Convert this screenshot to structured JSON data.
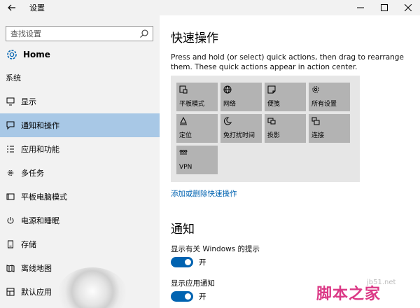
{
  "window": {
    "title": "设置"
  },
  "sidebar": {
    "search_placeholder": "查找设置",
    "home_label": "Home",
    "section_title": "系统",
    "items": [
      {
        "label": "显示",
        "icon": "display-icon"
      },
      {
        "label": "通知和操作",
        "icon": "notification-icon",
        "active": true
      },
      {
        "label": "应用和功能",
        "icon": "apps-list-icon"
      },
      {
        "label": "多任务",
        "icon": "multitask-icon"
      },
      {
        "label": "平板电脑模式",
        "icon": "tablet-icon"
      },
      {
        "label": "电源和睡眠",
        "icon": "power-icon"
      },
      {
        "label": "存储",
        "icon": "storage-icon"
      },
      {
        "label": "离线地图",
        "icon": "map-icon"
      },
      {
        "label": "默认应用",
        "icon": "default-apps-icon"
      }
    ]
  },
  "main": {
    "quick_actions_title": "快速操作",
    "quick_actions_desc": "Press and hold (or select) quick actions, then drag to rearrange them. These quick actions appear in action center.",
    "tiles": [
      {
        "label": "平板模式",
        "icon": "tablet-mode-icon"
      },
      {
        "label": "网络",
        "icon": "globe-icon"
      },
      {
        "label": "便笺",
        "icon": "note-icon"
      },
      {
        "label": "所有设置",
        "icon": "gear-icon"
      },
      {
        "label": "定位",
        "icon": "location-icon"
      },
      {
        "label": "免打扰时间",
        "icon": "moon-icon"
      },
      {
        "label": "投影",
        "icon": "project-icon"
      },
      {
        "label": "连接",
        "icon": "connect-icon"
      },
      {
        "label": "VPN",
        "icon": "vpn-icon"
      }
    ],
    "add_remove_link": "添加或删除快速操作",
    "notifications_title": "通知",
    "settings": [
      {
        "label": "显示有关 Windows 的提示",
        "state": "开"
      },
      {
        "label": "显示应用通知",
        "state": "开"
      }
    ]
  },
  "watermark": {
    "text": "脚本之家",
    "small": "jb51.net"
  },
  "colors": {
    "accent": "#0063b1",
    "active_nav": "#a8c8e6",
    "sidebar_bg": "#f2f2f2",
    "tile_bg": "#b3b3b3"
  }
}
